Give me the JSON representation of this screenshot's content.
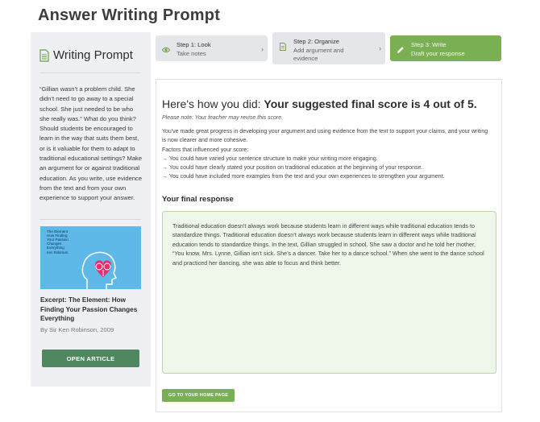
{
  "page": {
    "title": "Answer Writing Prompt"
  },
  "sidebar": {
    "header": "Writing Prompt",
    "header_icon": "document-icon",
    "prompt_text": "“Gillian wasn’t a problem child. She didn’t need to go away to a special school. She just needed to be who she really was.” What do you think? Should students be encouraged to learn in the way that suits them best, or is it valuable for them to adapt to traditional educational settings? Make an argument for or against traditional education. As you write, use evidence from the text and from your own experience to support your answer.",
    "book": {
      "cover_title": "The Element\nHow Finding\nYour Passion\nChanges\nEverything",
      "cover_author": "Ken Robinson",
      "cover_color": "#5eb8e8"
    },
    "excerpt_title": "Excerpt: The Element: How Finding Your Passion Changes Everything",
    "byline": "By Sir Ken Robinson, 2009",
    "open_button": "OPEN ARTICLE"
  },
  "steps": [
    {
      "label": "Step 1: Look",
      "sub": "Take notes",
      "icon": "eye-icon"
    },
    {
      "label": "Step 2: Organize",
      "sub": "Add argument and evidence",
      "icon": "document-icon"
    },
    {
      "label": "Step 3: Write",
      "sub": "Draft your response",
      "icon": "pencil-icon",
      "active": true
    }
  ],
  "main": {
    "score_prefix": "Here's how you did: ",
    "score_bold": "Your suggested final score is 4 out of 5.",
    "note": "Please note: Your teacher may revise this score.",
    "feedback_intro": "You've made great progress in developing your argument and using evidence from the text to support your claims, and your writing is now clearer and more cohesive.",
    "factors_label": "Factors that influenced your score:",
    "factors": [
      "→ You could have varied your sentence structure to make your writing more engaging.",
      "→ You could have clearly stated your position on traditional education at the beginning of your response.",
      "→ You could have included more examples from the text and your own experiences to strengthen your argument."
    ],
    "final_response_heading": "Your final response",
    "final_response": "Traditional education doesn't always work because students learn in different ways while traditional education tends to standardize things.  Traditional education doesn’t always work because students learn in different ways while traditional education tends to standardize things.  In the text, Gillian struggled in school.  She saw a doctor and he told her mother, “You know, Mrs. Lynne, Gillian isn’t sick. She’s a dancer. Take her to a dance school.”  When she went to the dance school and practiced her dancing, she was able to focus and think better.",
    "home_button": "GO TO YOUR HOME PAGE"
  },
  "colors": {
    "accent_green": "#7aaf53",
    "open_button": "#4f8760",
    "response_bg": "#eef7ea"
  }
}
